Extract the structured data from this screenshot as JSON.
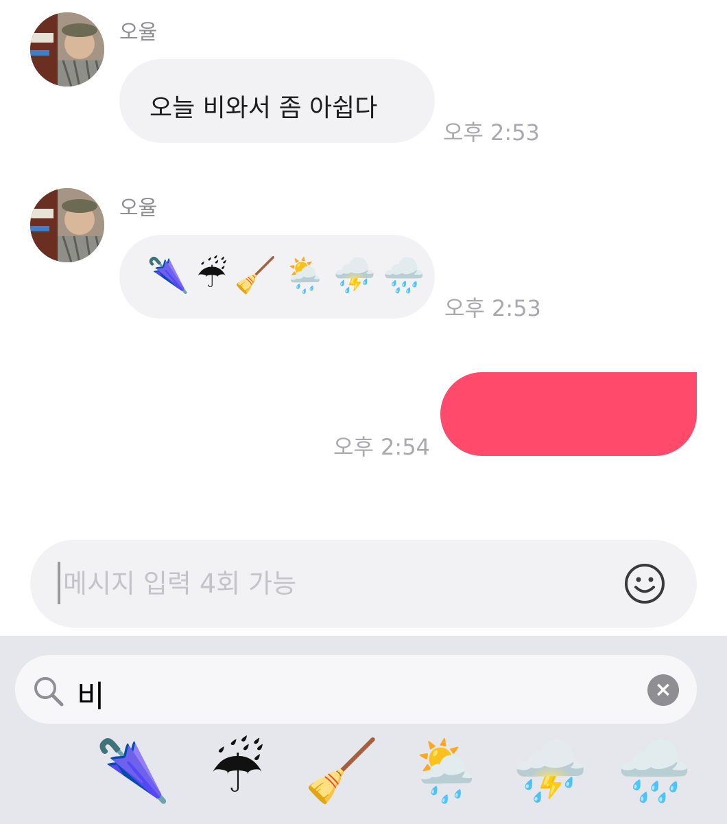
{
  "messages": [
    {
      "sender": "오율",
      "text": "오늘 비와서 좀 아쉽다",
      "time": "오후 2:53"
    },
    {
      "sender": "오율",
      "emojis": [
        "🌂",
        "☔",
        "🧹",
        "🌦️",
        "⛈️",
        "🌧️"
      ],
      "time": "오후 2:53"
    },
    {
      "time": "오후 2:54",
      "color": "#ff4a6b"
    }
  ],
  "composer": {
    "placeholder": "메시지 입력 4회 가능",
    "icon": "smile-icon"
  },
  "emoji_search": {
    "query": "비",
    "icon": "search-icon",
    "results": [
      "🌂",
      "☔",
      "🧹",
      "🌦️",
      "⛈️",
      "🌧️"
    ]
  }
}
